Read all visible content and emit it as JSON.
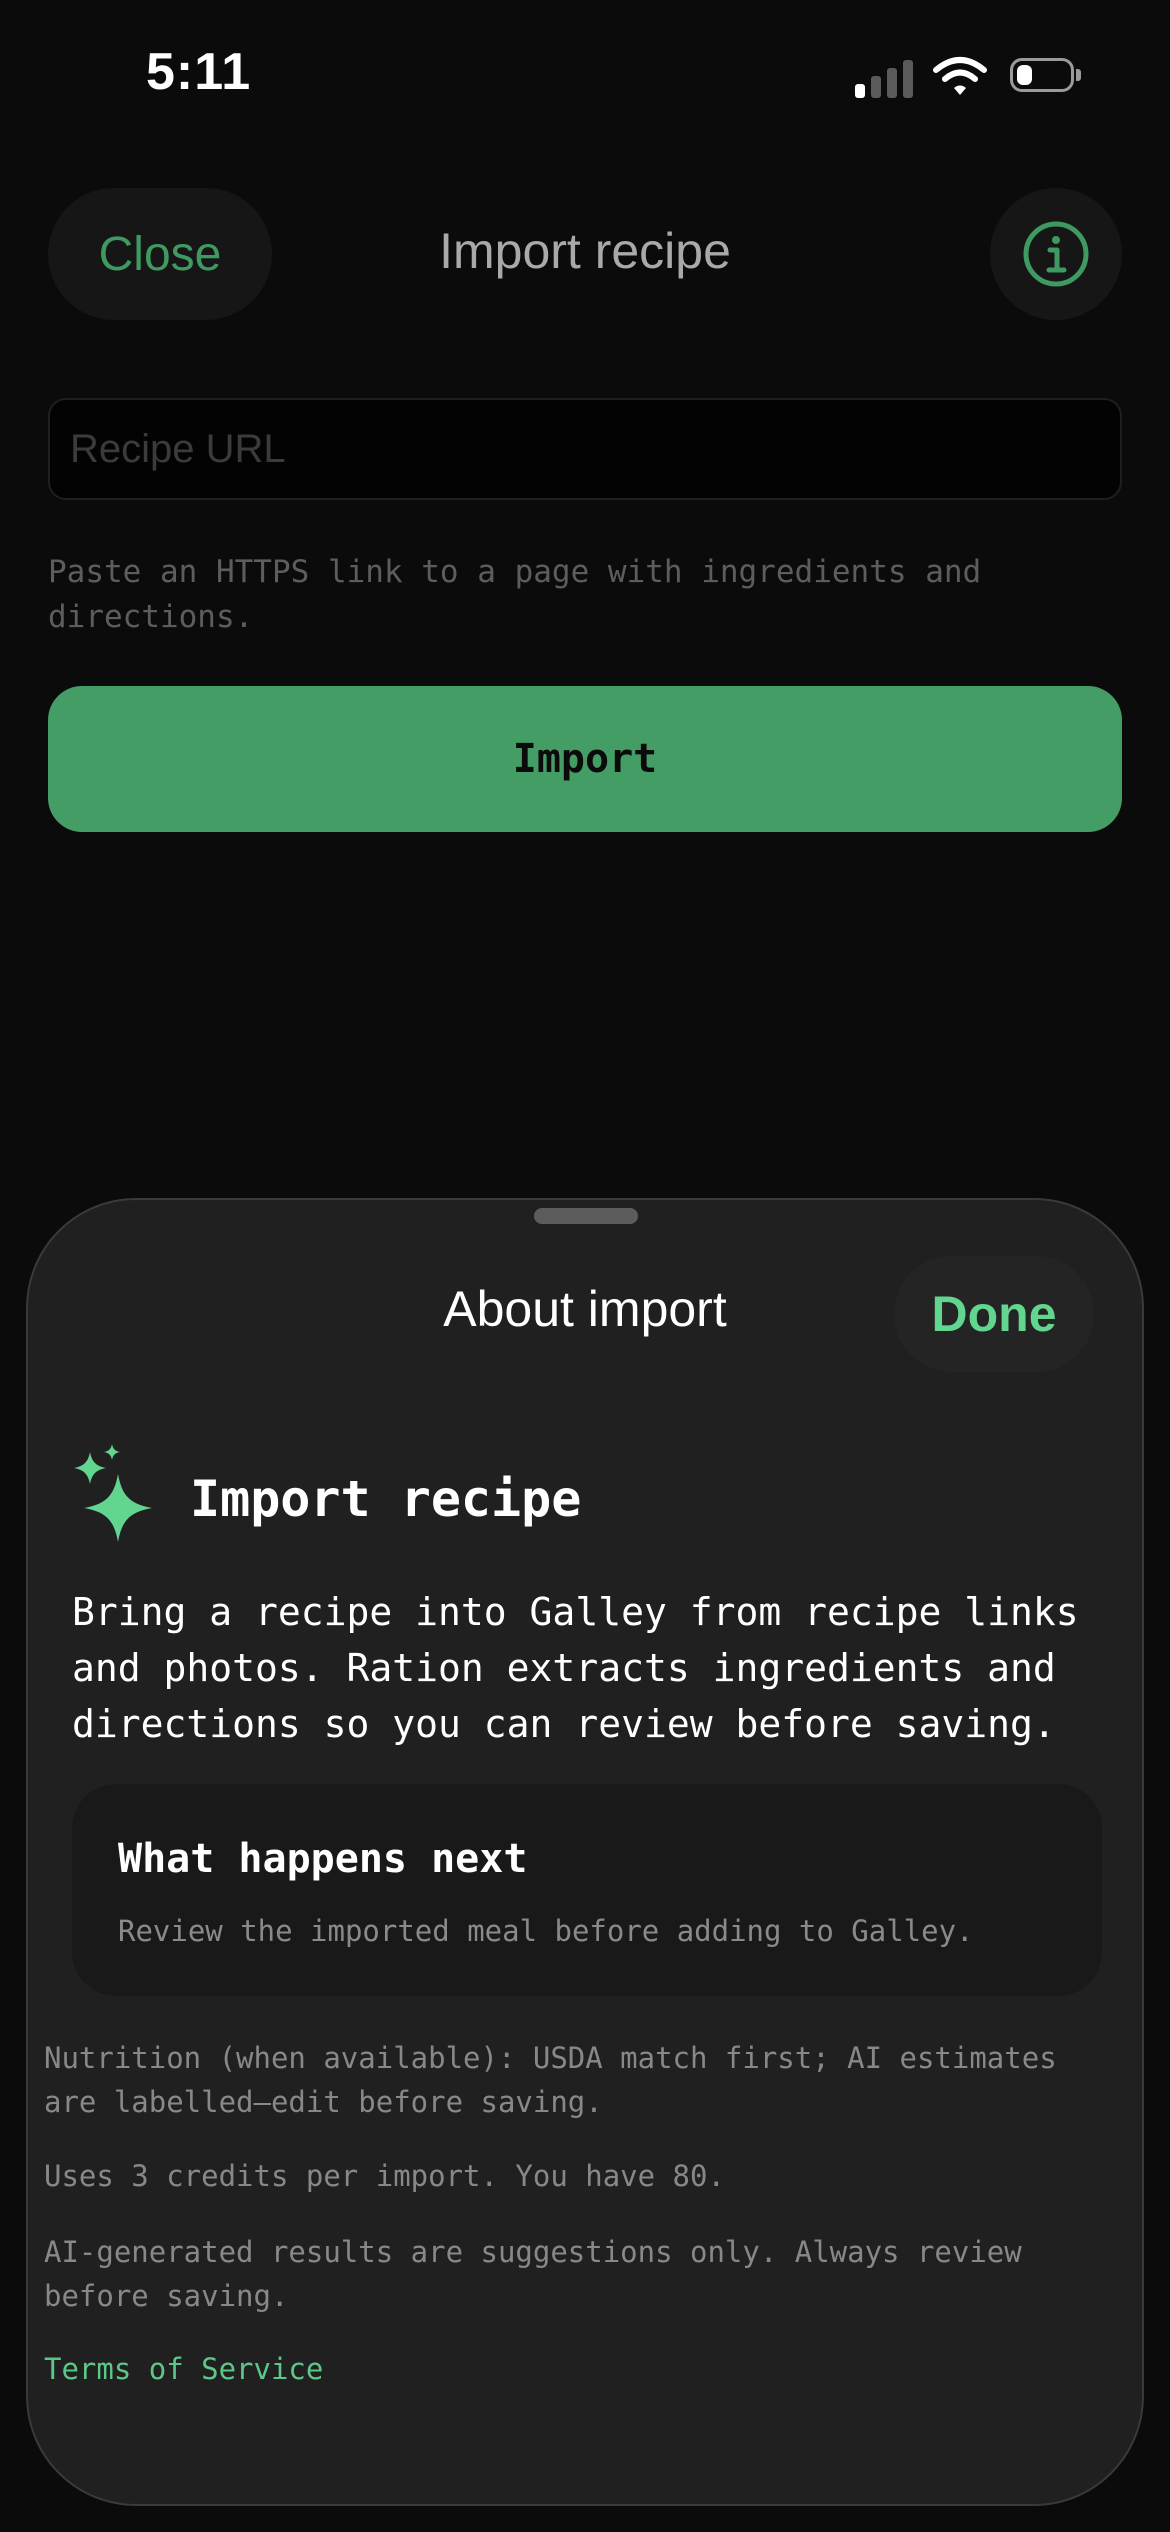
{
  "status_bar": {
    "time": "5:11",
    "signal_bars_active": 1,
    "battery_level": 0.3,
    "icons": [
      "cellular-signal-icon",
      "wifi-icon",
      "battery-icon"
    ]
  },
  "import_screen": {
    "close_label": "Close",
    "title": "Import recipe",
    "info_icon": "info-circle-icon",
    "url_placeholder": "Recipe URL",
    "url_value": "",
    "helper_text": "Paste an HTTPS link to a page with ingredients and directions.",
    "import_label": "Import"
  },
  "sheet": {
    "title": "About import",
    "done_label": "Done",
    "feature_icon": "sparkles-icon",
    "feature_title": "Import recipe",
    "feature_description": "Bring a recipe into Galley from recipe links and photos. Ration extracts ingredients and directions so you can review before saving.",
    "card": {
      "title": "What happens next",
      "description": "Review the imported meal before adding to Galley."
    },
    "notes": [
      "Nutrition (when available): USDA match first; AI estimates are labelled—edit before saving.",
      "Uses 3 credits per import. You have 80.",
      "AI-generated results are suggestions only. Always review before saving."
    ],
    "terms_label": "Terms of Service"
  },
  "colors": {
    "accent_green": "#62d58f",
    "button_green": "#459d66",
    "sheet_background": "#202020",
    "screen_background": "#0b0b0b"
  }
}
